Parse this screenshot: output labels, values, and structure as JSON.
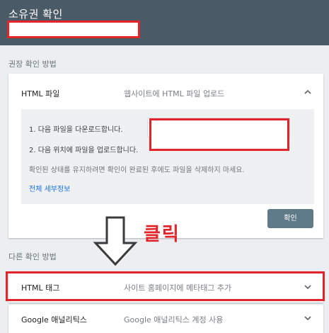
{
  "header": {
    "title": "소유권 확인"
  },
  "recommended": {
    "section_label": "권장 확인 방법",
    "html_file": {
      "title": "HTML 파일",
      "description": "웹사이트에 HTML 파일 업로드",
      "step1": "1. 다음 파일을 다운로드합니다.",
      "step2": "2. 다음 위치에 파일을 업로드합니다.",
      "note": "확인된 상태를 유지하려면 확인이 완료된 후에도 파일을 삭제하지 마세요.",
      "details_link": "전체 세부정보",
      "confirm_button": "확인"
    }
  },
  "annotation": {
    "click_label": "클릭"
  },
  "other": {
    "section_label": "다른 확인 방법",
    "html_tag": {
      "title": "HTML 태그",
      "description": "사이트 홈페이지에 메타태그 추가"
    },
    "google_analytics": {
      "title": "Google 애널리틱스",
      "description": "Google 애널리틱스 계정 사용"
    }
  },
  "colors": {
    "header": "#4a5a66",
    "highlight": "#e2252b",
    "button": "#5f7a88",
    "link": "#1a73e8"
  }
}
